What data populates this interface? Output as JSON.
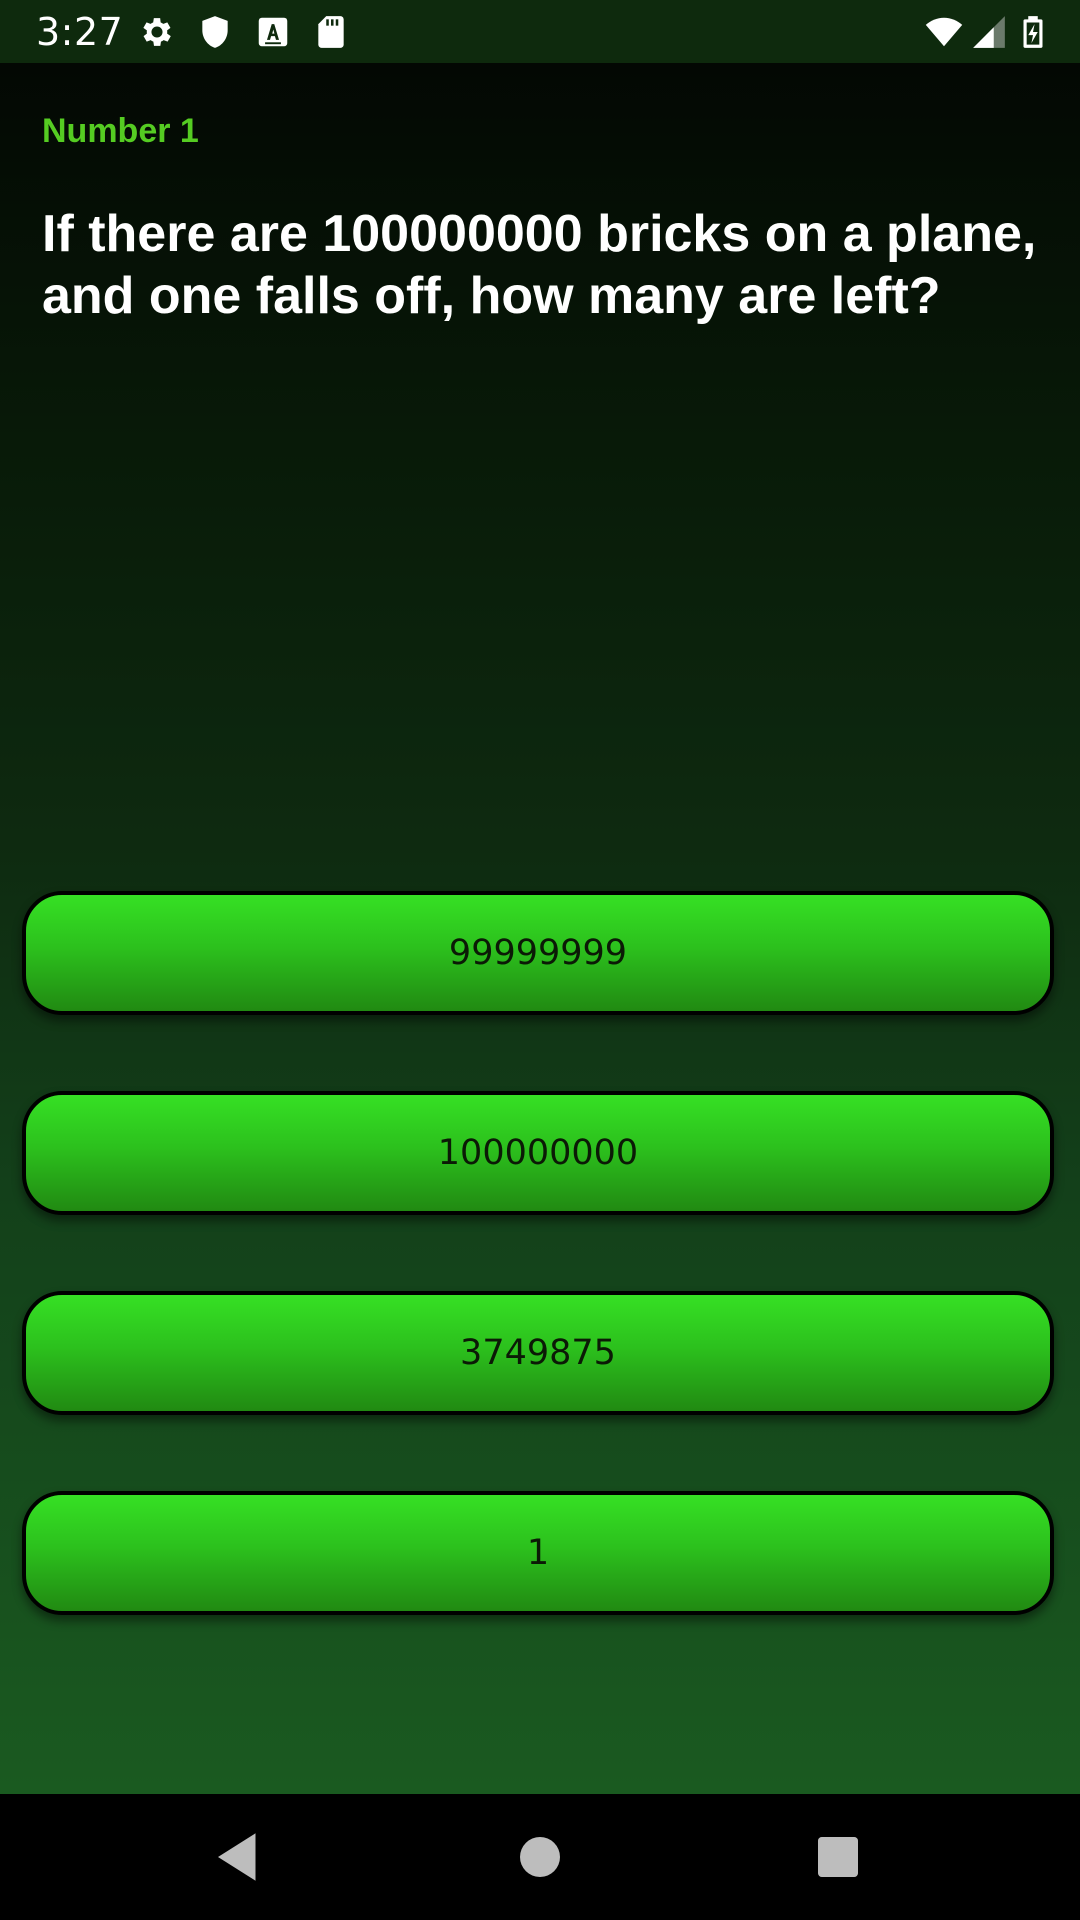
{
  "status_bar": {
    "time": "3:27",
    "left_icons": [
      "gear-icon",
      "shield-icon",
      "text-a-icon",
      "sd-card-icon"
    ],
    "right_icons": [
      "wifi-icon",
      "cell-signal-icon",
      "battery-charging-icon"
    ]
  },
  "quiz": {
    "number_label": "Number 1",
    "question": "If there are 100000000 bricks on a plane, and one falls off, how many are left?",
    "answers": [
      "99999999",
      "100000000",
      "3749875",
      "1"
    ]
  },
  "colors": {
    "accent_label": "#55cc22",
    "button_green": "#2cc11d",
    "background_top": "#030803",
    "background_bottom": "#1a5a20"
  },
  "nav_bar": {
    "icons": [
      "back-icon",
      "home-icon",
      "recents-icon"
    ]
  }
}
